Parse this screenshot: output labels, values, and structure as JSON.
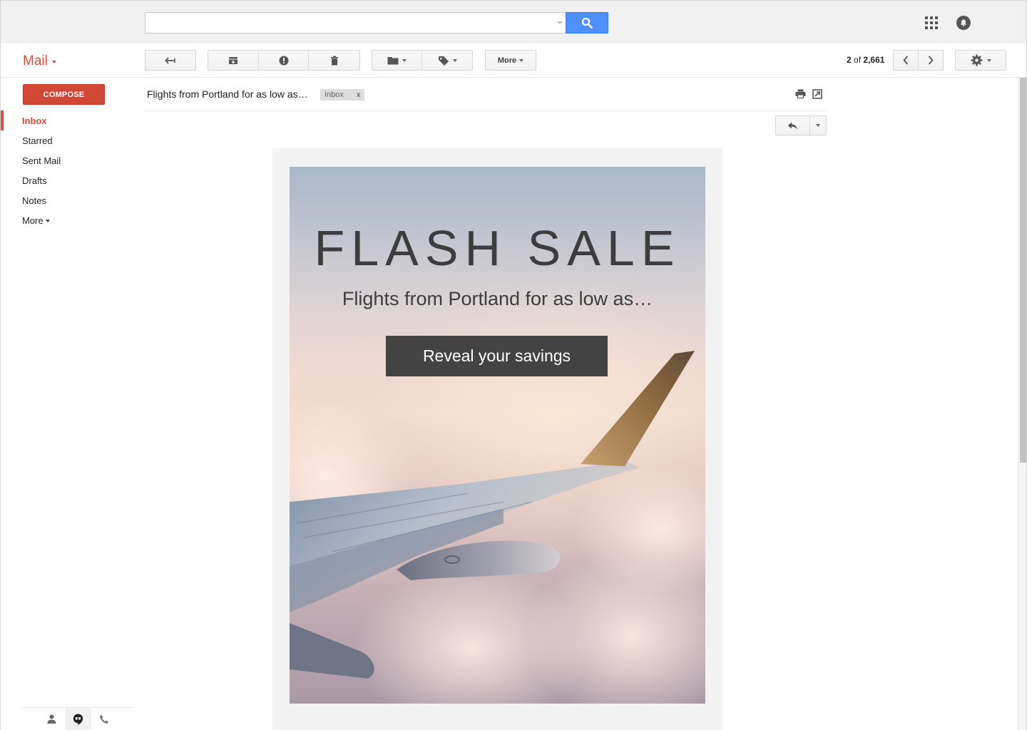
{
  "search": {
    "value": "",
    "placeholder": ""
  },
  "app": {
    "title": "Mail"
  },
  "compose_label": "COMPOSE",
  "sidebar": {
    "items": [
      {
        "label": "Inbox",
        "active": true
      },
      {
        "label": "Starred"
      },
      {
        "label": "Sent Mail"
      },
      {
        "label": "Drafts"
      },
      {
        "label": "Notes"
      },
      {
        "label": "More"
      }
    ]
  },
  "toolbar": {
    "more_label": "More",
    "pager": {
      "current": "2",
      "of_label": "of",
      "total": "2,661"
    }
  },
  "message": {
    "subject": "Flights from Portland for as low as…",
    "label_chip": "Inbox",
    "label_remove": "x"
  },
  "email": {
    "headline": "FLASH SALE",
    "subheadline": "Flights from Portland for as low as…",
    "cta": "Reveal your savings"
  },
  "colors": {
    "accent_red": "#dd4b39",
    "compose_red": "#d14836",
    "search_blue": "#4d90fe",
    "cta_bg": "#434343"
  },
  "icons": {
    "search": "search-icon",
    "apps": "apps-grid-icon",
    "notifications": "notifications-icon",
    "back": "back-arrow-icon",
    "archive": "archive-icon",
    "spam": "report-spam-icon",
    "delete": "trash-icon",
    "move": "folder-icon",
    "labels": "label-tag-icon",
    "prev": "chevron-left-icon",
    "next": "chevron-right-icon",
    "settings": "gear-icon",
    "print": "print-icon",
    "new_window": "new-window-icon",
    "reply": "reply-icon",
    "contacts": "person-icon",
    "hangouts": "hangouts-icon",
    "phone": "phone-icon"
  }
}
